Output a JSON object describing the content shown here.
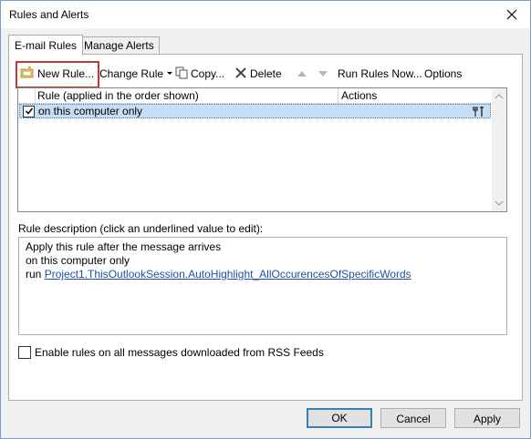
{
  "window": {
    "title": "Rules and Alerts"
  },
  "tabs": [
    {
      "label": "E-mail Rules",
      "active": true
    },
    {
      "label": "Manage Alerts",
      "active": false
    }
  ],
  "toolbar": {
    "new_rule": "New Rule...",
    "change_rule": "Change Rule",
    "copy": "Copy...",
    "delete": "Delete",
    "run_rules_now": "Run Rules Now...",
    "options": "Options"
  },
  "rules_list": {
    "columns": [
      "Rule (applied in the order shown)",
      "Actions"
    ],
    "rows": [
      {
        "name": "on this computer only",
        "checked": true,
        "selected": true
      }
    ]
  },
  "description": {
    "label": "Rule description (click an underlined value to edit):",
    "lines": [
      "Apply this rule after the message arrives",
      "on this computer only"
    ],
    "run_prefix": "run",
    "run_link": "Project1.ThisOutlookSession.AutoHighlight_AllOccurencesOfSpecificWords"
  },
  "rss_option": {
    "label": "Enable rules on all messages downloaded from RSS Feeds",
    "checked": false
  },
  "buttons": {
    "ok": "OK",
    "cancel": "Cancel",
    "apply": "Apply"
  },
  "colors": {
    "highlight_border": "#c0392b",
    "selection": "#c6ddf3",
    "link": "#1f4fa3"
  }
}
